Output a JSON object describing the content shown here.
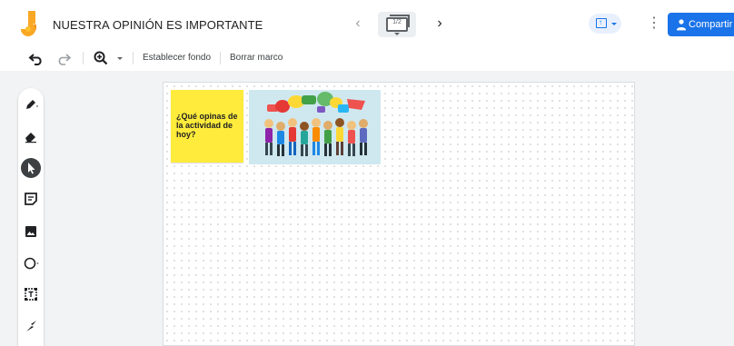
{
  "header": {
    "title": "NUESTRA OPINIÓN ES IMPORTANTE",
    "frame_counter": "1/2",
    "share_label": "Compartir"
  },
  "toolbar": {
    "set_background_label": "Establecer fondo",
    "clear_frame_label": "Borrar marco"
  },
  "canvas": {
    "sticky_note_text": "¿Qué opinas de la actividad de hoy?"
  },
  "icons": {
    "logo": "jamboard-logo",
    "undo": "undo-icon",
    "redo": "redo-icon",
    "zoom": "zoom-in-icon",
    "tools": [
      "pen-icon",
      "eraser-icon",
      "select-pointer-icon",
      "sticky-note-icon",
      "image-icon",
      "circle-shape-icon",
      "text-box-icon",
      "laser-icon"
    ]
  },
  "colors": {
    "accent": "#1a73e8",
    "sticky": "#ffeb3b",
    "logo_orange": "#f9a825"
  }
}
